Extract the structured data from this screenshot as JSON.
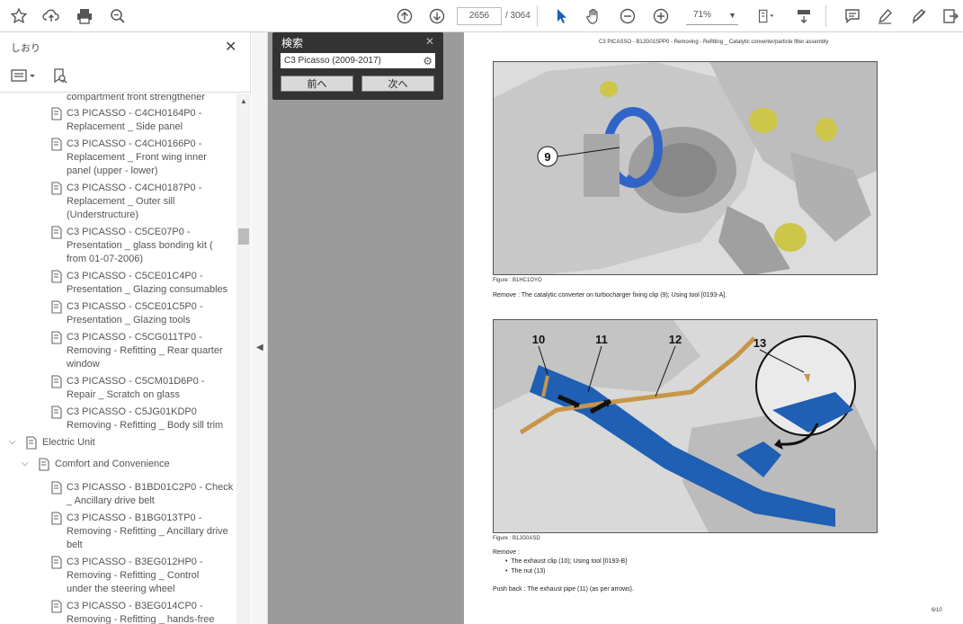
{
  "toolbar": {
    "current_page": "2656",
    "total_pages": "/ 3064",
    "zoom": "71%"
  },
  "sidebar": {
    "title": "しおり",
    "items": [
      {
        "line1": "compartment front strengthener",
        "line2": ""
      },
      {
        "line1": "C3 PICASSO - C4CH0164P0 -",
        "line2": "Replacement _ Side panel"
      },
      {
        "line1": "C3 PICASSO - C4CH0166P0 -",
        "line2": "Replacement _ Front wing inner",
        "line3": "panel (upper - lower)"
      },
      {
        "line1": "C3 PICASSO - C4CH0187P0 -",
        "line2": "Replacement _ Outer sill",
        "line3": "(Understructure)"
      },
      {
        "line1": "C3 PICASSO - C5CE07P0 -",
        "line2": "Presentation _ glass bonding kit (",
        "line3": "from 01-07-2006)"
      },
      {
        "line1": "C3 PICASSO - C5CE01C4P0 -",
        "line2": "Presentation _ Glazing consumables"
      },
      {
        "line1": "C3 PICASSO - C5CE01C5P0 -",
        "line2": "Presentation _ Glazing tools"
      },
      {
        "line1": "C3 PICASSO - C5CG011TP0 -",
        "line2": "Removing - Refitting _ Rear quarter",
        "line3": "window"
      },
      {
        "line1": "C3 PICASSO - C5CM01D6P0 -",
        "line2": "Repair _ Scratch on glass"
      },
      {
        "line1": "C3 PICASSO - C5JG01KDP0",
        "line2": "Removing - Refitting _ Body sill trim"
      }
    ],
    "group1": "Electric Unit",
    "group2": "Comfort and Convenience",
    "items2": [
      {
        "line1": "C3 PICASSO - B1BD01C2P0 - Check",
        "line2": "_ Ancillary drive belt"
      },
      {
        "line1": "C3 PICASSO - B1BG013TP0 -",
        "line2": "Removing - Refitting _ Ancillary drive",
        "line3": "belt"
      },
      {
        "line1": "C3 PICASSO - B3EG012HP0 -",
        "line2": "Removing - Refitting _ Control",
        "line3": "under the steering wheel"
      },
      {
        "line1": "C3 PICASSO - B3EG014CP0 -",
        "line2": "Removing - Refitting _ hands-free"
      }
    ]
  },
  "search": {
    "title": "検索",
    "query": "C3 Picasso (2009-2017)",
    "prev": "前へ",
    "next": "次へ"
  },
  "page": {
    "header": "C3 PICASSO - B1JG01SPP0 - Removing - Refitting _ Catalytic converter/particle filter assembly",
    "fig1_caption": "Figure : B1HC1OYO",
    "remove1": "Remove : The catalytic converter on turbocharger fixing clip (9); Using tool [0193-A].",
    "fig2_caption": "Figure : B1JG0ASD",
    "remove_label": "Remove :",
    "bullet1": "The exhaust clip (10); Using tool [0193-B]",
    "bullet2": "The nut (13)",
    "push_back": "Push back : The exhaust pipe (11) (as per arrows).",
    "page_number": "6/10",
    "callouts": [
      "9",
      "10",
      "11",
      "12",
      "13"
    ]
  }
}
